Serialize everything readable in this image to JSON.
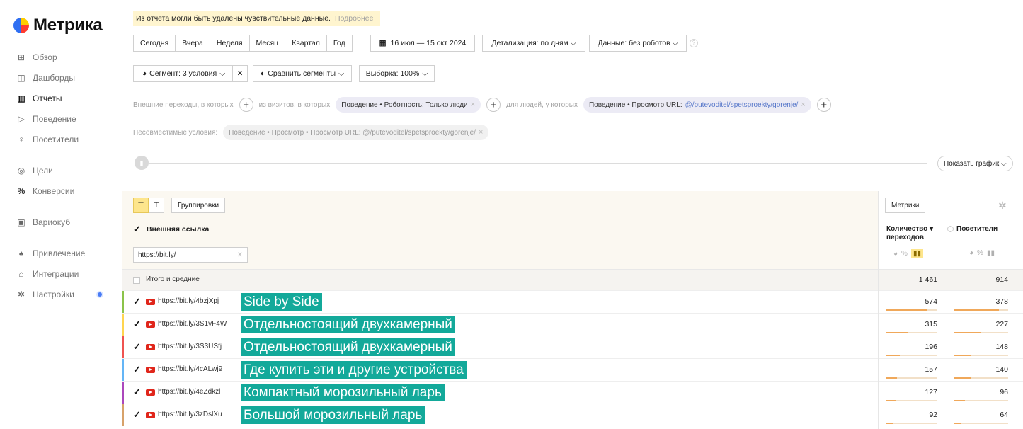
{
  "sidebar": {
    "logo": "Метрика",
    "items": [
      {
        "label": "Обзор",
        "icon": "grid-icon"
      },
      {
        "label": "Дашборды",
        "icon": "dashboard-icon"
      },
      {
        "label": "Отчеты",
        "icon": "reports-icon",
        "active": true
      },
      {
        "label": "Поведение",
        "icon": "play-icon"
      },
      {
        "label": "Посетители",
        "icon": "user-icon"
      },
      {
        "label": "Цели",
        "icon": "target-icon"
      },
      {
        "label": "Конверсии",
        "icon": "percent-icon"
      },
      {
        "label": "Вариокуб",
        "icon": "cube-icon"
      },
      {
        "label": "Привлечение",
        "icon": "fire-icon"
      },
      {
        "label": "Интеграции",
        "icon": "integration-icon"
      },
      {
        "label": "Настройки",
        "icon": "gear-icon"
      }
    ]
  },
  "notice": {
    "text": "Из отчета могли быть удалены чувствительные данные.",
    "more": "Подробнее"
  },
  "periods": [
    "Сегодня",
    "Вчера",
    "Неделя",
    "Месяц",
    "Квартал",
    "Год"
  ],
  "date_range": "16 июл — 15 окт 2024",
  "detail": "Детализация: по дням",
  "data_filter": "Данные: без роботов",
  "segment": {
    "label": "Сегмент: 3 условия",
    "compare": "Сравнить сегменты",
    "sample": "Выборка: 100%"
  },
  "conditions": {
    "ext": "Внешние переходы, в которых",
    "visits": "из визитов, в которых",
    "pill1": "Поведение • Роботность: Только люди",
    "people": "для людей, у которых",
    "pill2_prefix": "Поведение • Просмотр URL:",
    "pill2_url": "@/putevoditel/spetsproekty/gorenje/",
    "incompat_label": "Несовместимые условия:",
    "incompat_pill": "Поведение • Просмотр • Просмотр URL: @/putevoditel/spetsproekty/gorenje/"
  },
  "show_graph": "Показать график",
  "table": {
    "groupings": "Группировки",
    "metrics_btn": "Метрики",
    "dimension": "Внешняя ссылка",
    "filter_value": "https://bit.ly/",
    "col1": "Количество ▾ переходов",
    "col2": "Посетители",
    "pct": "%",
    "total_label": "Итого и средние",
    "total": {
      "visits": "1 461",
      "visitors": "914"
    },
    "rows": [
      {
        "link": "https://bit.ly/4bzjXpj",
        "title": "Side by Side",
        "visits": "574",
        "visitors": "378",
        "color": "#8bc34a",
        "share_visits": 0.393,
        "share_visitors": 0.414
      },
      {
        "link": "https://bit.ly/3S1vF4W",
        "title": "Отдельностоящий двухкамерный",
        "visits": "315",
        "visitors": "227",
        "color": "#ffd54f",
        "share_visits": 0.216,
        "share_visitors": 0.248
      },
      {
        "link": "https://bit.ly/3S3USfj",
        "title": "Отдельностоящий двухкамерный",
        "visits": "196",
        "visitors": "148",
        "color": "#ef5350",
        "share_visits": 0.134,
        "share_visitors": 0.162
      },
      {
        "link": "https://bit.ly/4cALwj9",
        "title": "Где купить эти и другие устройства",
        "visits": "157",
        "visitors": "140",
        "color": "#64b5f6",
        "share_visits": 0.107,
        "share_visitors": 0.153
      },
      {
        "link": "https://bit.ly/4eZdkzl",
        "title": "Компактный морозильный ларь",
        "visits": "127",
        "visitors": "96",
        "color": "#ab47bc",
        "share_visits": 0.087,
        "share_visitors": 0.105
      },
      {
        "link": "https://bit.ly/3zDslXu",
        "title": "Большой морозильный ларь",
        "visits": "92",
        "visitors": "64",
        "color": "#d7a26a",
        "share_visits": 0.063,
        "share_visitors": 0.07
      }
    ]
  }
}
